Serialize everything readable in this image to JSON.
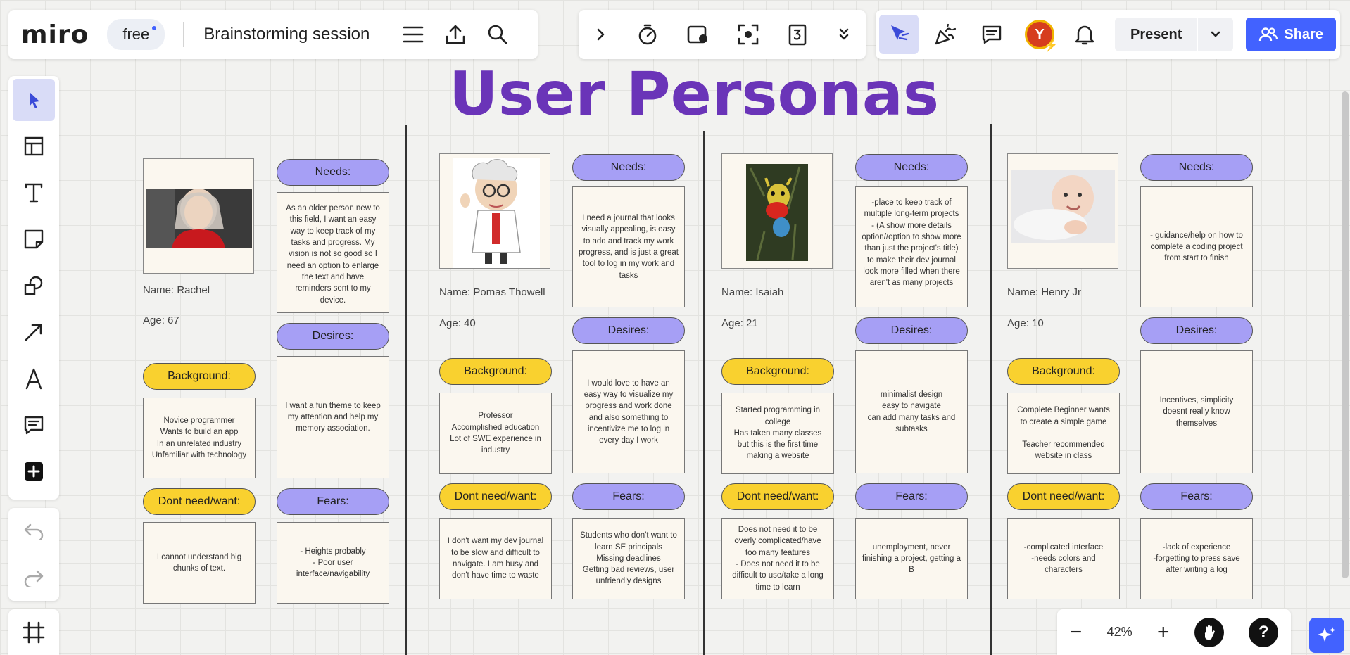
{
  "app": {
    "logo": "miro",
    "plan": "free",
    "board_title": "Brainstorming session"
  },
  "topbar": {
    "present_label": "Present",
    "share_label": "Share",
    "avatar_initial": "Y"
  },
  "zoom": {
    "level": "42%",
    "minus": "−",
    "plus": "+",
    "help": "?"
  },
  "board": {
    "heading": "User Personas"
  },
  "personas": [
    {
      "name": "Name: Rachel",
      "age": "Age: 67",
      "needs_label": "Needs:",
      "needs": "As an older person new to this field, I want an easy way to keep track of my tasks and progress. My vision is not so good so I need an option to enlarge the text and have reminders sent to my device.",
      "desires_label": "Desires:",
      "desires": "I want a fun theme to keep my attention and help my memory association.",
      "background_label": "Background:",
      "background": "Novice programmer\nWants to build an app\nIn an unrelated industry\nUnfamiliar with technology",
      "dont_label": "Dont need/want:",
      "dont": "I cannot understand big chunks of text.",
      "fears_label": "Fears:",
      "fears": "- Heights probably\n- Poor user interface/navigability"
    },
    {
      "name": "Name: Pomas Thowell",
      "age": "Age: 40",
      "needs_label": "Needs:",
      "needs": "I need a journal that looks visually appealing, is easy to add and track my work progress, and is just a great tool to log in my work and tasks",
      "desires_label": "Desires:",
      "desires": "I would love to have an easy way to visualize my progress and work done and also something to incentivize me to log in every day I work",
      "background_label": "Background:",
      "background": "Professor\nAccomplished education\nLot of SWE experience in industry",
      "dont_label": "Dont need/want:",
      "dont": "I don't want my dev journal to be slow and difficult to navigate. I am busy and don't have time to waste",
      "fears_label": "Fears:",
      "fears": "Students who don't want to learn SE principals\nMissing deadlines\nGetting bad reviews, user unfriendly designs"
    },
    {
      "name": "Name: Isaiah",
      "age": "Age: 21",
      "needs_label": "Needs:",
      "needs": "-place to keep track of multiple long-term projects\n- (A show more details option//option to show more than just the project's title) to make their dev journal look more filled when there aren't as many projects",
      "desires_label": "Desires:",
      "desires": "minimalist design\neasy to navigate\ncan add many tasks and subtasks",
      "background_label": "Background:",
      "background": "Started programming in college\nHas taken many classes but this is the first time making a website",
      "dont_label": "Dont need/want:",
      "dont": "Does not need it to be overly complicated/have too many features\n- Does not need it to be difficult to use/take a long time to learn",
      "fears_label": "Fears:",
      "fears": "unemployment, never finishing a project, getting a B"
    },
    {
      "name": "Name: Henry Jr",
      "age": "Age: 10",
      "needs_label": "Needs:",
      "needs": "- guidance/help on how to complete a coding project from start to finish",
      "desires_label": "Desires:",
      "desires": "Incentives, simplicity\ndoesnt really know themselves",
      "background_label": "Background:",
      "background": "Complete Beginner wants to create a simple game\n\nTeacher recommended website in class",
      "dont_label": "Dont need/want:",
      "dont": "-complicated interface\n-needs colors and characters",
      "fears_label": "Fears:",
      "fears": "-lack of experience\n-forgetting to press save after writing a log"
    }
  ],
  "colors": {
    "accent": "#4262ff",
    "heading": "#6a34b8",
    "pill_purple": "#a69ff5",
    "pill_yellow": "#f9d12f"
  }
}
